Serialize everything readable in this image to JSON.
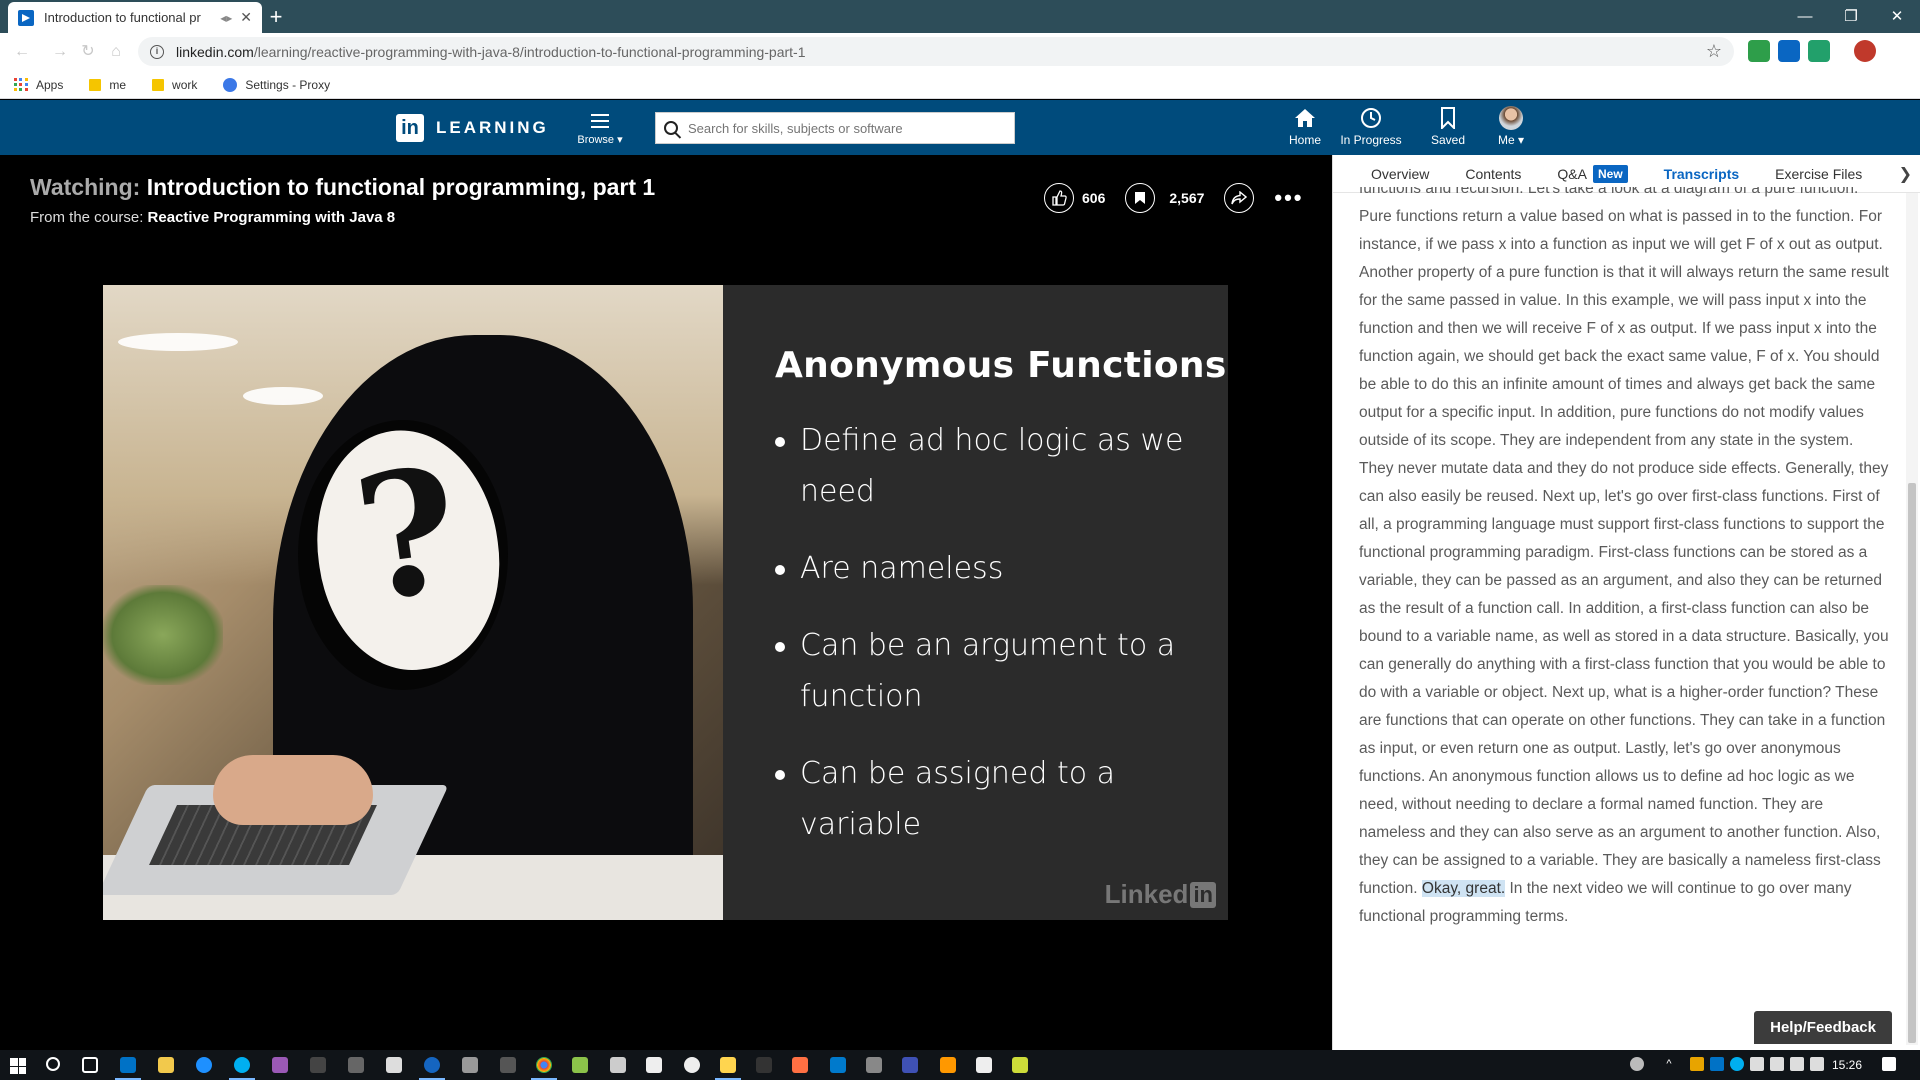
{
  "browser": {
    "tab_title": "Introduction to functional pr",
    "url_host": "linkedin.com",
    "url_path": "/learning/reactive-programming-with-java-8/introduction-to-functional-programming-part-1",
    "new_tab": "+",
    "bookmarks": [
      {
        "label": "Apps",
        "icon": "apps-grid-icon"
      },
      {
        "label": "me",
        "icon": "folder-icon"
      },
      {
        "label": "work",
        "icon": "folder-icon"
      },
      {
        "label": "Settings - Proxy",
        "icon": "gear-icon"
      }
    ]
  },
  "header": {
    "logo_in": "in",
    "logo_text": "LEARNING",
    "browse_label": "Browse ▾",
    "search_placeholder": "Search for skills, subjects or software",
    "nav": {
      "home": "Home",
      "in_progress": "In Progress",
      "saved": "Saved",
      "me": "Me ▾"
    }
  },
  "video": {
    "watching_label": "Watching:",
    "title": "Introduction to functional programming, part 1",
    "from_label": "From the course:",
    "course": "Reactive Programming with Java 8",
    "likes": "606",
    "saves": "2,567",
    "more": "•••"
  },
  "slide": {
    "heading": "Anonymous Functions",
    "bullets": [
      "Define ad hoc logic as we need",
      "Are nameless",
      "Can be an argument to a function",
      "Can be assigned to a variable"
    ],
    "watermark_text": "Linked",
    "watermark_in": "in"
  },
  "panel": {
    "tabs": {
      "overview": "Overview",
      "contents": "Contents",
      "qa": "Q&A",
      "qa_badge": "New",
      "transcripts": "Transcripts",
      "exercise": "Exercise Files"
    },
    "transcript_before": "functions and recursion. Let's take a look at a diagram of a pure function. Pure functions return a value based on what is passed in to the function. For instance, if we pass x into a function as input we will get F of x out as output. Another property of a pure function is that it will always return the same result for the same passed in value. In this example, we will pass input x into the function and then we will receive F of x as output. If we pass input x into the function again, we should get back the exact same value, F of x. You should be able to do this an infinite amount of times and always get back the same output for a specific input. In addition, pure functions do not modify values outside of its scope. They are independent from any state in the system. They never mutate data and they do not produce side effects. Generally, they can also easily be reused. Next up, let's go over first-class functions. First of all, a programming language must support first-class functions to support the functional programming paradigm. First-class functions can be stored as a variable, they can be passed as an argument, and also they can be returned as the result of a function call. In addition, a first-class function can also be bound to a variable name, as well as stored in a data structure. Basically, you can generally do anything with a first-class function that you would be able to do with a variable or object. Next up, what is a higher-order function? These are functions that can operate on other functions. They can take in a function as input, or even return one as output. Lastly, let's go over anonymous functions. An anonymous function allows us to define ad hoc logic as we need, without needing to declare a formal named function. They are nameless and they can also serve as an argument to another function. Also, they can be assigned to a variable. They are basically a nameless first-class function. ",
    "transcript_highlight": "Okay, great.",
    "transcript_after": " In the next video we will continue to go over many functional programming terms.",
    "help_button": "Help/Feedback"
  },
  "taskbar": {
    "clock": "15:26"
  }
}
